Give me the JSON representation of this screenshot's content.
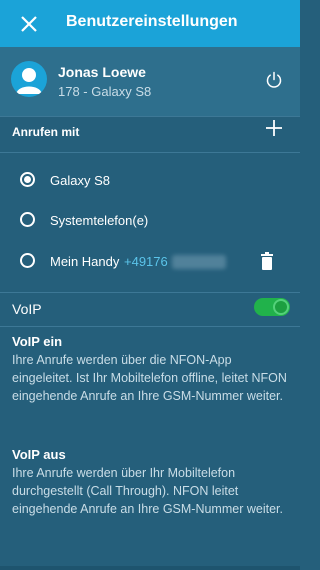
{
  "header": {
    "title": "Benutzereinstellungen",
    "close_icon": "close-icon",
    "background_color": "#1ba3d8"
  },
  "user": {
    "name": "Jonas Loewe",
    "device": "178 - Galaxy S8",
    "avatar_icon": "person-icon",
    "power_icon": "power-icon"
  },
  "calling": {
    "section_label": "Anrufen mit",
    "add_icon": "plus-icon",
    "options": [
      {
        "label": "Galaxy S8",
        "selected": true
      },
      {
        "label": "Systemtelefon(e)",
        "selected": false
      },
      {
        "label": "Mein Handy",
        "number": "+49176",
        "selected": false,
        "delete_icon": "trash-icon"
      }
    ]
  },
  "voip": {
    "label": "VoIP",
    "enabled": true,
    "toggle_color": "#21b24b",
    "on_heading": "VoIP ein",
    "on_text": "Ihre Anrufe werden über die NFON-App eingeleitet. Ist Ihr Mobiltelefon offline, leitet NFON eingehende Anrufe an Ihre GSM-Nummer weiter.",
    "off_heading": "VoIP aus",
    "off_text": "Ihre Anrufe werden über Ihr Mobiltelefon durchgestellt (Call Through). NFON leitet eingehende Anrufe an Ihre GSM-Nummer weiter."
  },
  "colors": {
    "background": "#255f7b",
    "accent": "#1ba3d8",
    "number_link": "#5bc4ea"
  }
}
